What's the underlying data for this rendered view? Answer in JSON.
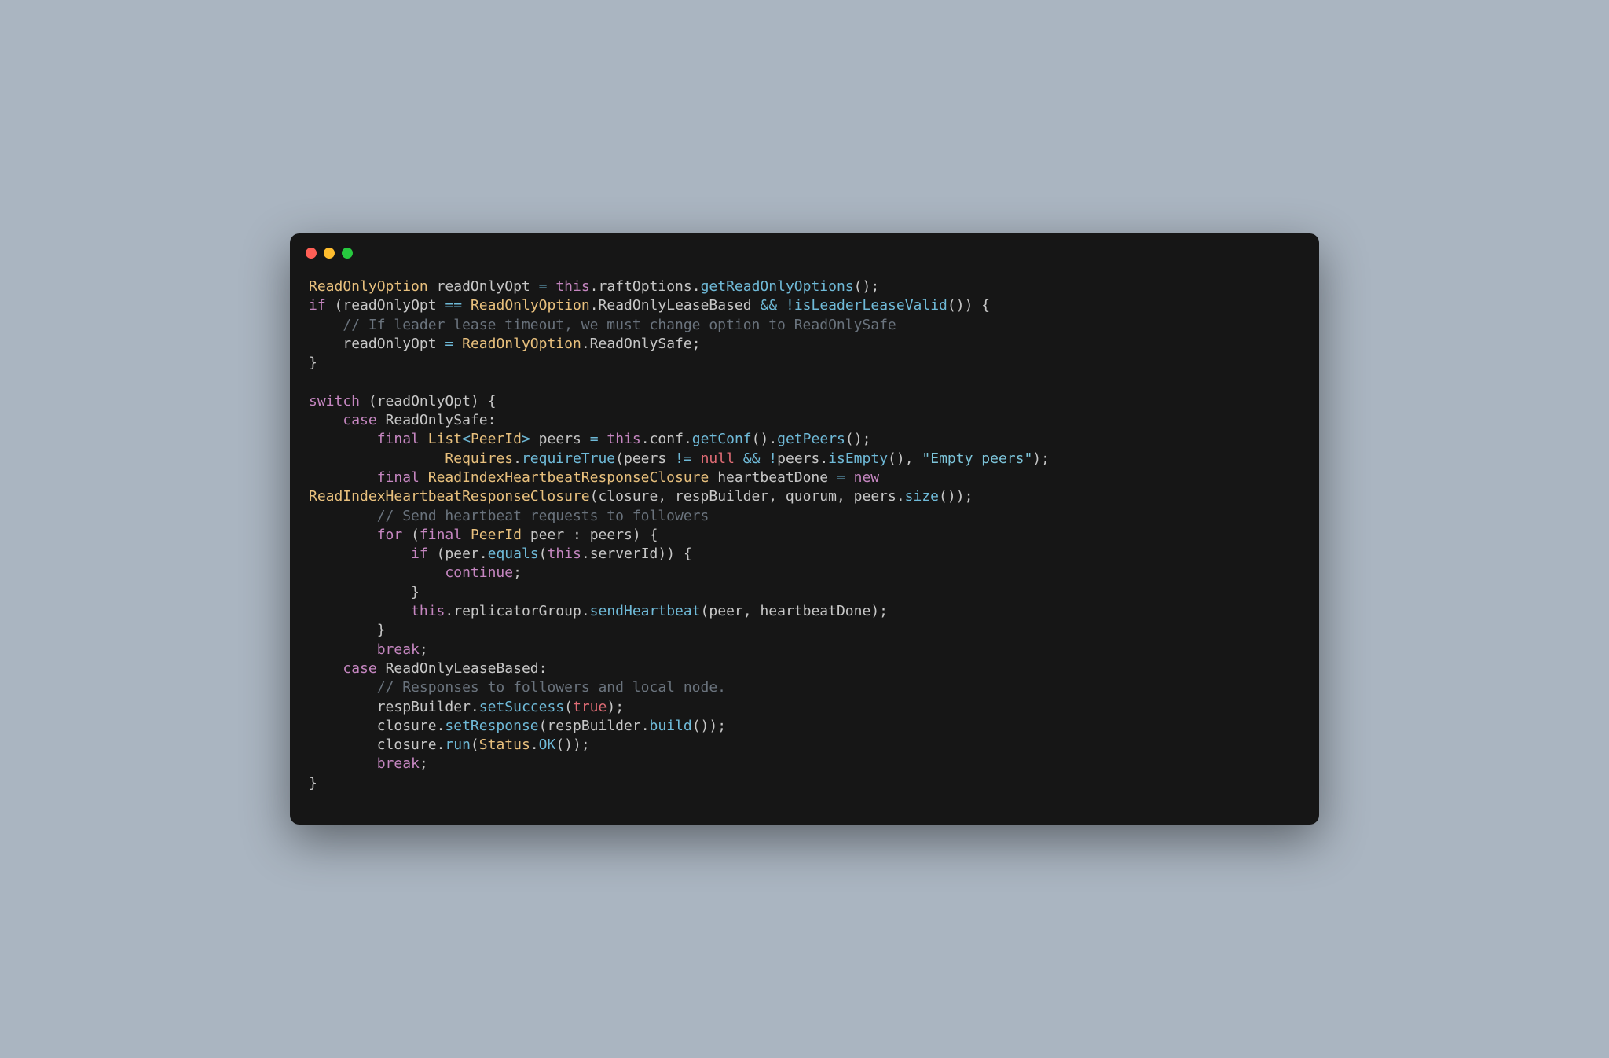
{
  "traffic": {
    "red": "#ff5f56",
    "yellow": "#ffbd2e",
    "green": "#27c93f"
  },
  "code": {
    "line1": {
      "t1": "ReadOnlyOption",
      "v1": "readOnlyOpt",
      "eq": "=",
      "this": "this",
      "dot": ".",
      "f1": "raftOptions",
      "m1": "getReadOnlyOptions",
      "paren": "()",
      "semi": ";"
    },
    "line2": {
      "if": "if",
      "lp": "(",
      "v1": "readOnlyOpt",
      "eqeq": "==",
      "t1": "ReadOnlyOption",
      "dot": ".",
      "f1": "ReadOnlyLeaseBased",
      "and": "&&",
      "bang": "!",
      "m1": "isLeaderLeaseValid",
      "paren": "()",
      "rp": ")",
      "lb": "{"
    },
    "line3": {
      "cmt": "// If leader lease timeout, we must change option to ReadOnlySafe"
    },
    "line4": {
      "v1": "readOnlyOpt",
      "eq": "=",
      "t1": "ReadOnlyOption",
      "dot": ".",
      "f1": "ReadOnlySafe",
      "semi": ";"
    },
    "line5": {
      "rb": "}"
    },
    "line7": {
      "switch": "switch",
      "lp": "(",
      "v1": "readOnlyOpt",
      "rp": ")",
      "lb": "{"
    },
    "line8": {
      "case": "case",
      "f1": "ReadOnlySafe",
      "colon": ":"
    },
    "line9": {
      "final": "final",
      "t1": "List",
      "lt": "<",
      "t2": "PeerId",
      "gt": ">",
      "v1": "peers",
      "eq": "=",
      "this": "this",
      "dot": ".",
      "f1": "conf",
      "m1": "getConf",
      "paren1": "()",
      "m2": "getPeers",
      "paren2": "()",
      "semi": ";"
    },
    "line10": {
      "t1": "Requires",
      "dot": ".",
      "m1": "requireTrue",
      "lp": "(",
      "v1": "peers",
      "ne": "!=",
      "null": "null",
      "and": "&&",
      "bang": "!",
      "v2": "peers",
      "m2": "isEmpty",
      "paren": "()",
      "comma": ",",
      "str": "\"Empty peers\"",
      "rp": ")",
      "semi": ";"
    },
    "line11": {
      "final": "final",
      "t1": "ReadIndexHeartbeatResponseClosure",
      "v1": "heartbeatDone",
      "eq": "=",
      "new": "new"
    },
    "line12": {
      "t1": "ReadIndexHeartbeatResponseClosure",
      "lp": "(",
      "a1": "closure",
      "c1": ",",
      "a2": "respBuilder",
      "c2": ",",
      "a3": "quorum",
      "c3": ",",
      "a4": "peers",
      "dot": ".",
      "m1": "size",
      "paren": "()",
      "rp": ")",
      "semi": ";"
    },
    "line13": {
      "cmt": "// Send heartbeat requests to followers"
    },
    "line14": {
      "for": "for",
      "lp": "(",
      "final": "final",
      "t1": "PeerId",
      "v1": "peer",
      "colon": ":",
      "v2": "peers",
      "rp": ")",
      "lb": "{"
    },
    "line15": {
      "if": "if",
      "lp": "(",
      "v1": "peer",
      "dot": ".",
      "m1": "equals",
      "lp2": "(",
      "this": "this",
      "dot2": ".",
      "f1": "serverId",
      "rp2": ")",
      "rp": ")",
      "lb": "{"
    },
    "line16": {
      "continue": "continue",
      "semi": ";"
    },
    "line17": {
      "rb": "}"
    },
    "line18": {
      "this": "this",
      "dot": ".",
      "f1": "replicatorGroup",
      "dot2": ".",
      "m1": "sendHeartbeat",
      "lp": "(",
      "a1": "peer",
      "comma": ",",
      "a2": "heartbeatDone",
      "rp": ")",
      "semi": ";"
    },
    "line19": {
      "rb": "}"
    },
    "line20": {
      "break": "break",
      "semi": ";"
    },
    "line21": {
      "case": "case",
      "f1": "ReadOnlyLeaseBased",
      "colon": ":"
    },
    "line22": {
      "cmt": "// Responses to followers and local node."
    },
    "line23": {
      "v1": "respBuilder",
      "dot": ".",
      "m1": "setSuccess",
      "lp": "(",
      "true": "true",
      "rp": ")",
      "semi": ";"
    },
    "line24": {
      "v1": "closure",
      "dot": ".",
      "m1": "setResponse",
      "lp": "(",
      "a1": "respBuilder",
      "dot2": ".",
      "m2": "build",
      "paren": "()",
      "rp": ")",
      "semi": ";"
    },
    "line25": {
      "v1": "closure",
      "dot": ".",
      "m1": "run",
      "lp": "(",
      "t1": "Status",
      "dot2": ".",
      "m2": "OK",
      "paren": "()",
      "rp": ")",
      "semi": ";"
    },
    "line26": {
      "break": "break",
      "semi": ";"
    },
    "line27": {
      "rb": "}"
    }
  }
}
